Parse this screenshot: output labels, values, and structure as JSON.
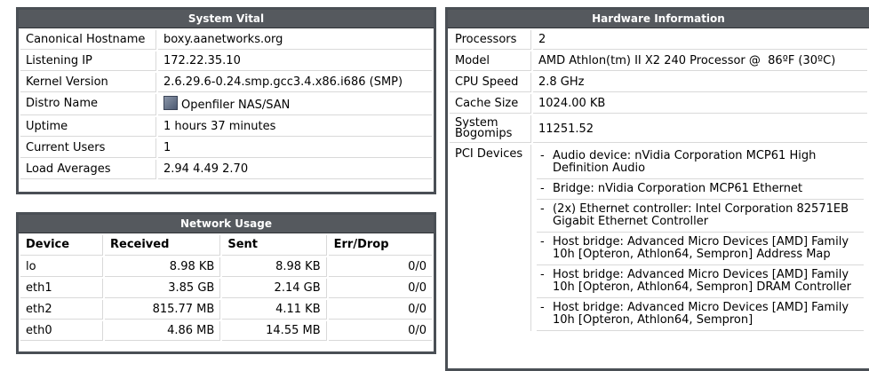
{
  "system_vital": {
    "title": "System Vital",
    "rows": [
      {
        "label": "Canonical Hostname",
        "value": "boxy.aanetworks.org"
      },
      {
        "label": "Listening IP",
        "value": "172.22.35.10"
      },
      {
        "label": "Kernel Version",
        "value": "2.6.29.6-0.24.smp.gcc3.4.x86.i686 (SMP)"
      },
      {
        "label": "Distro Name",
        "value": "Openfiler NAS/SAN"
      },
      {
        "label": "Uptime",
        "value": "1 hours 37 minutes"
      },
      {
        "label": "Current Users",
        "value": "1"
      },
      {
        "label": "Load Averages",
        "value": "2.94 4.49 2.70"
      }
    ]
  },
  "network_usage": {
    "title": "Network Usage",
    "headers": [
      "Device",
      "Received",
      "Sent",
      "Err/Drop"
    ],
    "rows": [
      [
        "lo",
        "8.98 KB",
        "8.98 KB",
        "0/0"
      ],
      [
        "eth1",
        "3.85 GB",
        "2.14 GB",
        "0/0"
      ],
      [
        "eth2",
        "815.77 MB",
        "4.11 KB",
        "0/0"
      ],
      [
        "eth0",
        "4.86 MB",
        "14.55 MB",
        "0/0"
      ]
    ]
  },
  "hardware": {
    "title": "Hardware Information",
    "rows": [
      {
        "label": "Processors",
        "value": "2"
      },
      {
        "label": "Model",
        "value": "AMD Athlon(tm) II X2 240 Processor @  86ºF (30ºC)"
      },
      {
        "label": "CPU Speed",
        "value": "2.8 GHz"
      },
      {
        "label": "Cache Size",
        "value": "1024.00 KB"
      },
      {
        "label": "System Bogomips",
        "value": "11251.52"
      }
    ],
    "pci_label": "PCI Devices",
    "pci_devices": [
      "Audio device: nVidia Corporation MCP61 High Definition Audio",
      "Bridge: nVidia Corporation MCP61 Ethernet",
      "(2x) Ethernet controller: Intel Corporation 82571EB Gigabit Ethernet Controller",
      "Host bridge: Advanced Micro Devices [AMD] Family 10h [Opteron, Athlon64, Sempron] Address Map",
      "Host bridge: Advanced Micro Devices [AMD] Family 10h [Opteron, Athlon64, Sempron] DRAM Controller",
      "Host bridge: Advanced Micro Devices [AMD] Family 10h [Opteron, Athlon64, Sempron]"
    ]
  }
}
